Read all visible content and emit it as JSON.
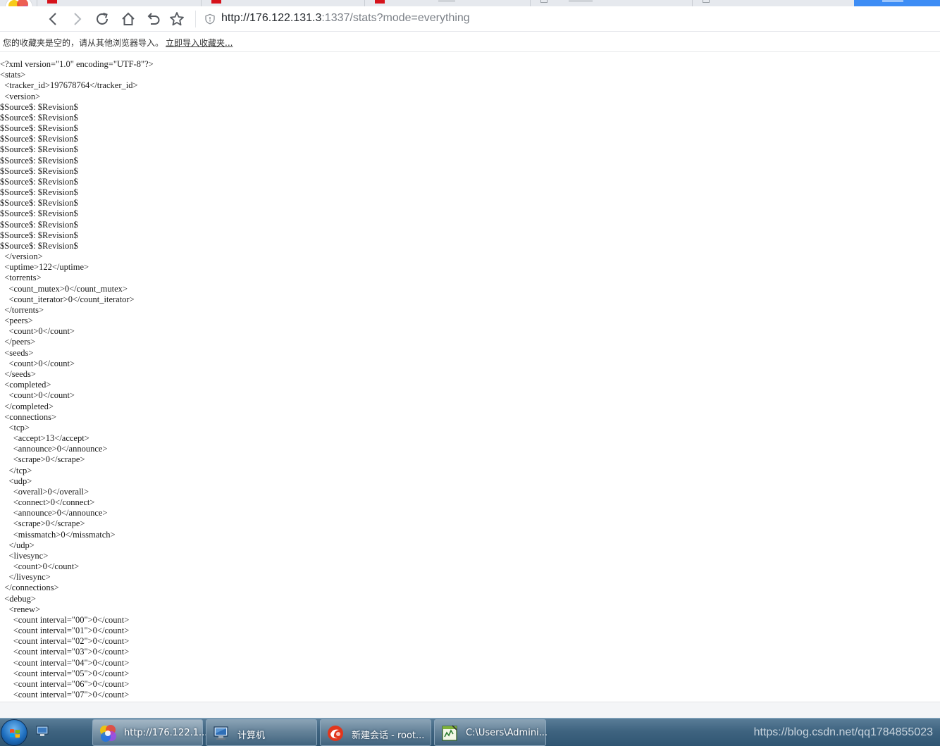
{
  "browser": {
    "url_host": "http://176.122.131.3",
    "url_rest": ":1337/stats?mode=everything",
    "bookmarks_empty_message": "您的收藏夹是空的，请从其他浏览器导入。",
    "bookmarks_import_link": "立即导入收藏夹..."
  },
  "xml_lines": [
    "<?xml version=\"1.0\" encoding=\"UTF-8\"?>",
    "<stats>",
    "  <tracker_id>197678764</tracker_id>",
    "  <version>",
    "$Source$: $Revision$",
    "$Source$: $Revision$",
    "$Source$: $Revision$",
    "$Source$: $Revision$",
    "$Source$: $Revision$",
    "$Source$: $Revision$",
    "$Source$: $Revision$",
    "$Source$: $Revision$",
    "$Source$: $Revision$",
    "$Source$: $Revision$",
    "$Source$: $Revision$",
    "$Source$: $Revision$",
    "$Source$: $Revision$",
    "$Source$: $Revision$",
    "  </version>",
    "  <uptime>122</uptime>",
    "  <torrents>",
    "    <count_mutex>0</count_mutex>",
    "    <count_iterator>0</count_iterator>",
    "  </torrents>",
    "  <peers>",
    "    <count>0</count>",
    "  </peers>",
    "  <seeds>",
    "    <count>0</count>",
    "  </seeds>",
    "  <completed>",
    "    <count>0</count>",
    "  </completed>",
    "  <connections>",
    "    <tcp>",
    "      <accept>13</accept>",
    "      <announce>0</announce>",
    "      <scrape>0</scrape>",
    "    </tcp>",
    "    <udp>",
    "      <overall>0</overall>",
    "      <connect>0</connect>",
    "      <announce>0</announce>",
    "      <scrape>0</scrape>",
    "      <missmatch>0</missmatch>",
    "    </udp>",
    "    <livesync>",
    "      <count>0</count>",
    "    </livesync>",
    "  </connections>",
    "  <debug>",
    "    <renew>",
    "      <count interval=\"00\">0</count>",
    "      <count interval=\"01\">0</count>",
    "      <count interval=\"02\">0</count>",
    "      <count interval=\"03\">0</count>",
    "      <count interval=\"04\">0</count>",
    "      <count interval=\"05\">0</count>",
    "      <count interval=\"06\">0</count>",
    "      <count interval=\"07\">0</count>"
  ],
  "taskbar": {
    "items": [
      {
        "label": "http://176.122.1...",
        "icon": "browser-icon"
      },
      {
        "label": "计算机",
        "icon": "computer-icon"
      },
      {
        "label": "新建会话 - root...",
        "icon": "session-icon"
      },
      {
        "label": "C:\\Users\\Admini...",
        "icon": "terminal-icon"
      }
    ],
    "watermark": "https://blog.csdn.net/qq1784855023"
  },
  "icons": [
    "back-icon",
    "forward-icon",
    "reload-icon",
    "home-icon",
    "undo-icon",
    "star-icon",
    "shield-icon",
    "windows-start-icon",
    "show-desktop-icon"
  ],
  "colors": {
    "active_tab": "#3d8df5",
    "tab_favicon": "#d6131b",
    "taskbar": "#3f6480"
  }
}
